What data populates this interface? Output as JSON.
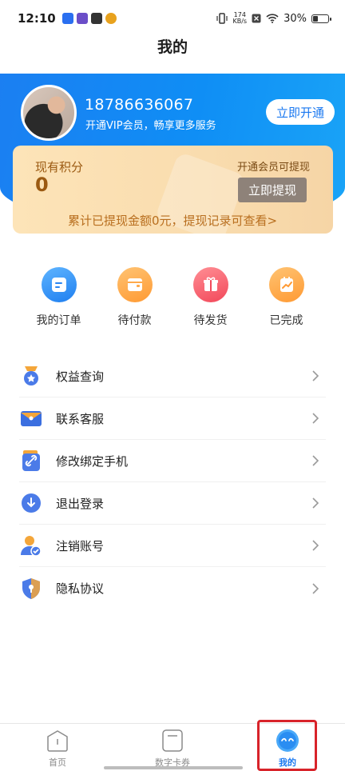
{
  "status_bar": {
    "time": "12:10",
    "net_speed_value": "174",
    "net_speed_unit": "KB/s",
    "battery": "30%"
  },
  "page": {
    "title": "我的"
  },
  "profile": {
    "phone": "18786636067",
    "vip_subtitle": "开通VIP会员，畅享更多服务",
    "open_button": "立即开通"
  },
  "points_card": {
    "label": "现有积分",
    "value": "0",
    "vip_hint": "开通会员可提现",
    "withdraw_button": "立即提现",
    "record_text": "累计已提现金额0元，提现记录可查看>"
  },
  "orders": [
    {
      "label": "我的订单",
      "icon": "order-list-icon"
    },
    {
      "label": "待付款",
      "icon": "wallet-icon"
    },
    {
      "label": "待发货",
      "icon": "gift-box-icon"
    },
    {
      "label": "已完成",
      "icon": "chart-check-icon"
    }
  ],
  "menu": [
    {
      "label": "权益查询",
      "icon": "medal-star-icon"
    },
    {
      "label": "联系客服",
      "icon": "mail-icon"
    },
    {
      "label": "修改绑定手机",
      "icon": "link-icon"
    },
    {
      "label": "退出登录",
      "icon": "logout-icon"
    },
    {
      "label": "注销账号",
      "icon": "user-check-icon"
    },
    {
      "label": "隐私协议",
      "icon": "shield-lock-icon"
    }
  ],
  "bottom_nav": [
    {
      "label": "首页",
      "icon": "home-icon"
    },
    {
      "label": "数字卡券",
      "icon": "card-coupon-icon"
    },
    {
      "label": "我的",
      "icon": "profile-smile-icon",
      "active": true
    }
  ],
  "colors": {
    "primary": "#1a78f0",
    "card_text": "#9b5a12",
    "highlight": "#d8232a"
  }
}
